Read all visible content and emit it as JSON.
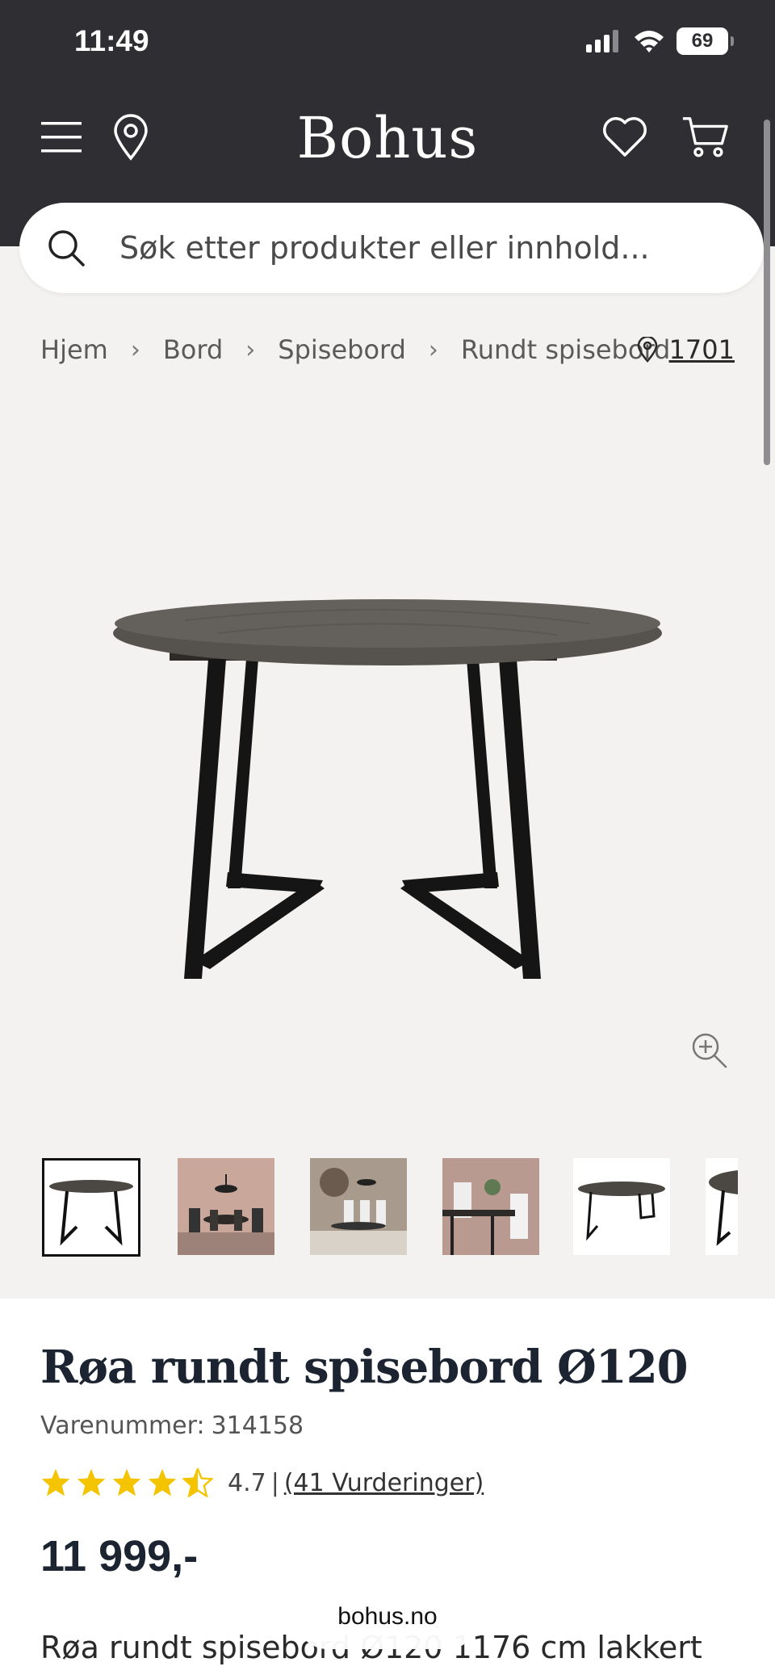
{
  "status_bar": {
    "time": "11:49",
    "battery": "69"
  },
  "header": {
    "logo": "Bohus"
  },
  "search": {
    "placeholder": "Søk etter produkter eller innhold..."
  },
  "breadcrumb": {
    "items": [
      "Hjem",
      "Bord",
      "Spisebord",
      "Rundt spisebord"
    ],
    "store": "1701"
  },
  "product": {
    "title": "Røa rundt spisebord Ø120",
    "sku_label": "Varenummer:",
    "sku": "314158",
    "rating": 4.7,
    "rating_text": "4.7",
    "rating_separator": "|",
    "reviews_label": "(41 Vurderinger)",
    "price": "11 999,-",
    "description": "Røa rundt spisebord Ø120 1176 cm lakkert"
  },
  "browser": {
    "url": "bohus.no"
  },
  "colors": {
    "header_bg": "#2f2f33",
    "page_bg": "#f4f2f0",
    "star": "#f5c400",
    "title": "#1b2430"
  },
  "icons": [
    "menu-icon",
    "location-pin-icon",
    "heart-icon",
    "cart-icon",
    "search-icon",
    "zoom-in-icon",
    "star-icon"
  ]
}
